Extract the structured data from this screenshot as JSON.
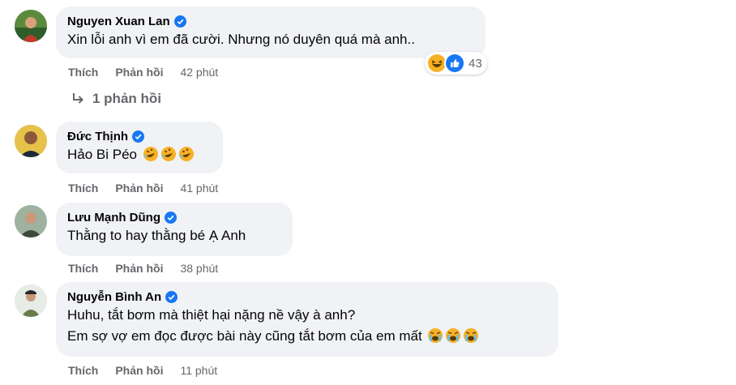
{
  "comments": [
    {
      "name": "Nguyen Xuan Lan",
      "lines": [
        "Xin lỗi anh vì em đã cười. Nhưng nó duyên quá mà anh.."
      ],
      "time": "42 phút",
      "like_label": "Thích",
      "reply_label": "Phản hồi",
      "reactions": {
        "count": "43",
        "icons": [
          "haha-icon",
          "like-icon"
        ]
      },
      "replies_label": "1 phản hồi"
    },
    {
      "name": "Đức Thịnh",
      "lines": [
        "Hảo Bi Péo"
      ],
      "emojis": [
        "rofl-emoji",
        "rofl-emoji",
        "rofl-emoji"
      ],
      "time": "41 phút",
      "like_label": "Thích",
      "reply_label": "Phản hồi"
    },
    {
      "name": "Lưu Mạnh Dũng",
      "lines": [
        "Thằng to hay thằng bé Ạ Anh"
      ],
      "time": "38 phút",
      "like_label": "Thích",
      "reply_label": "Phản hồi"
    },
    {
      "name": "Nguyễn Bình An",
      "lines": [
        "Huhu, tắt bơm mà thiệt hại nặng nề vậy à anh?",
        "Em sợ vợ em đọc được bài này cũng tắt bơm của em mất"
      ],
      "emojis": [
        "crying-emoji",
        "crying-emoji",
        "crying-emoji"
      ],
      "time": "11 phút",
      "like_label": "Thích",
      "reply_label": "Phản hồi"
    }
  ],
  "colors": {
    "bubble": "#f0f2f5",
    "meta": "#65676b",
    "verified": "#1877f2"
  }
}
